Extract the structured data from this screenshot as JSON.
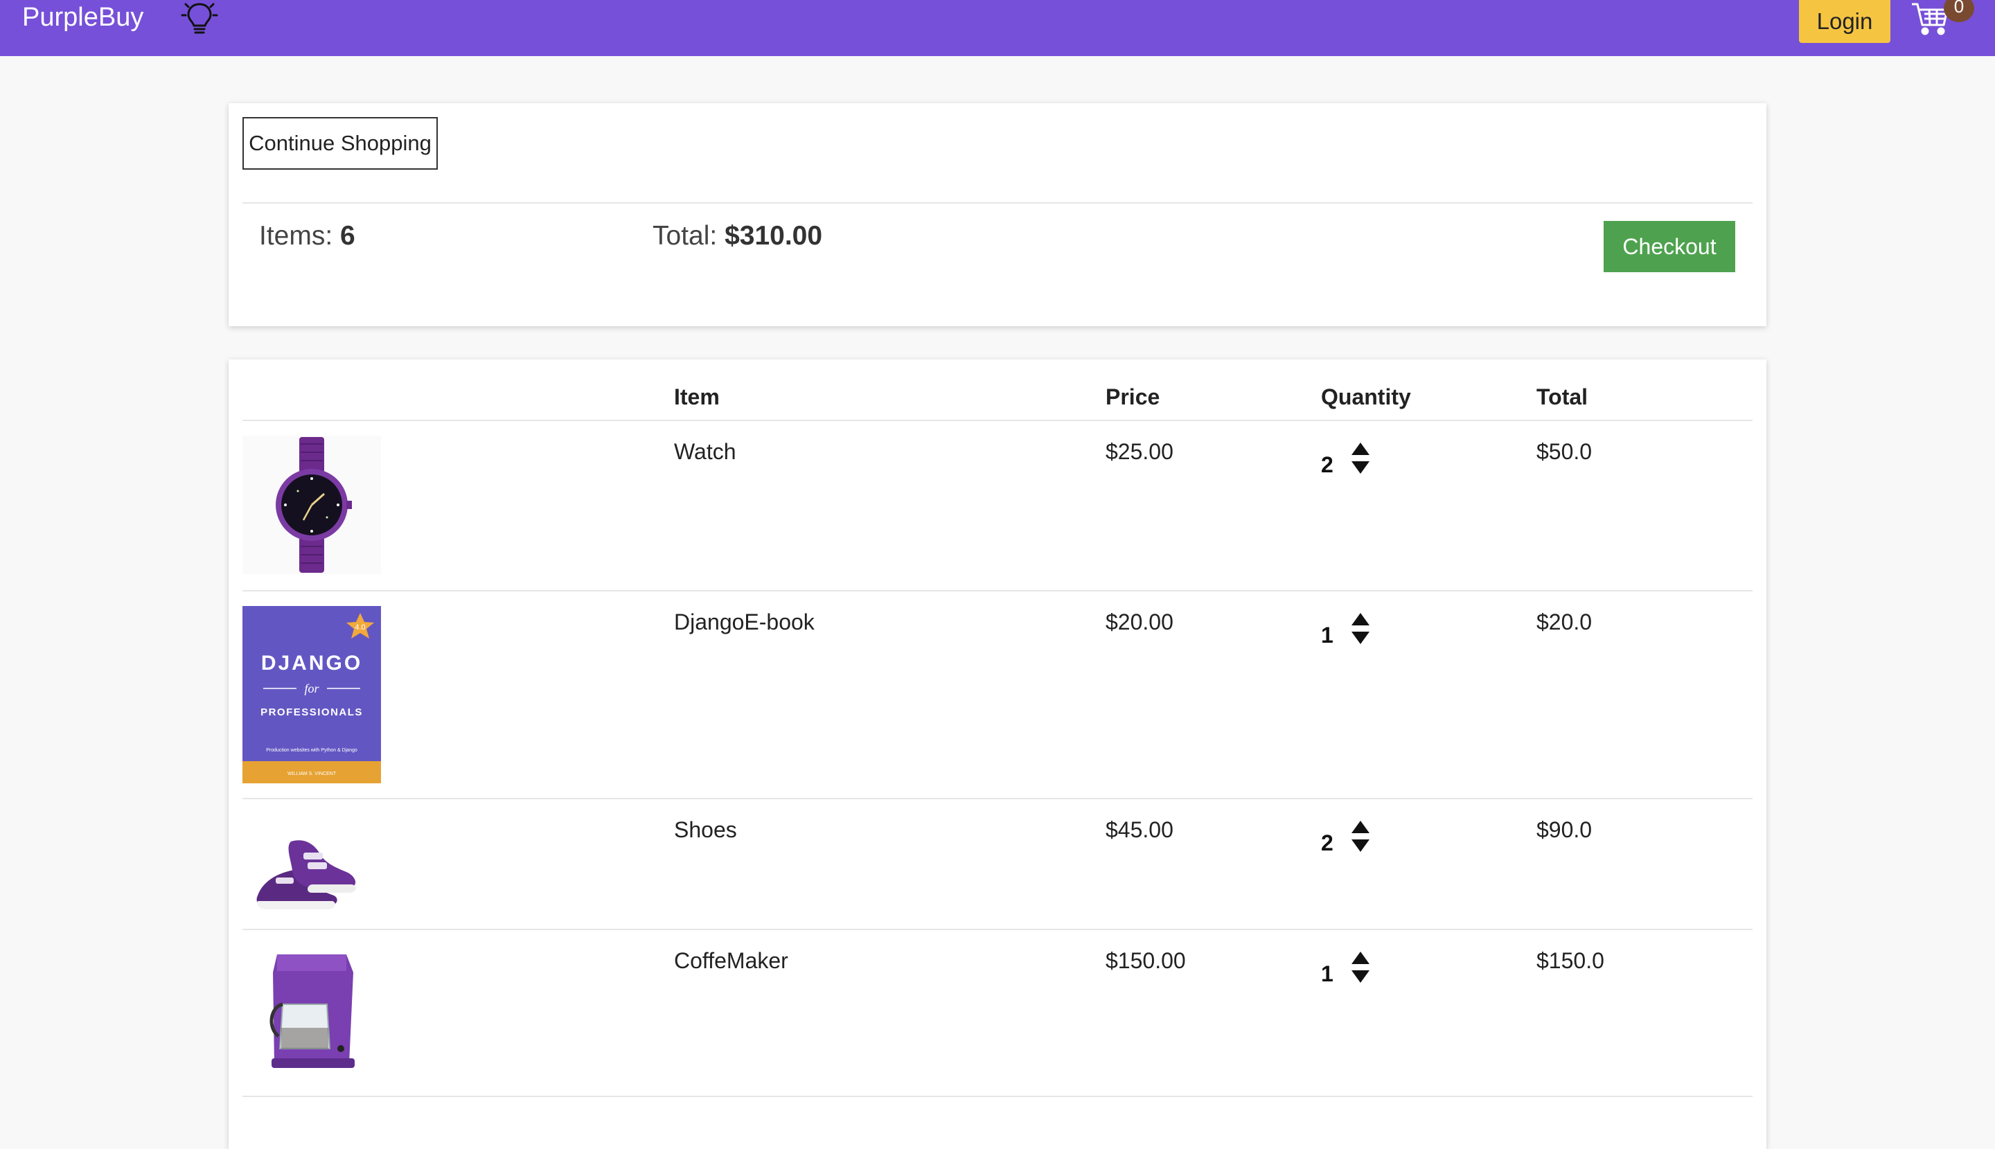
{
  "navbar": {
    "brand": "PurpleBuy",
    "login_label": "Login",
    "cart_count": "0",
    "color": "#7650d8"
  },
  "summary": {
    "continue_label": "Continue Shopping",
    "items_label": "Items:",
    "items_value": "6",
    "total_label": "Total:",
    "total_value": "$310.00",
    "checkout_label": "Checkout"
  },
  "table": {
    "headers": [
      "Item",
      "Price",
      "Quantity",
      "Total"
    ],
    "rows": [
      {
        "item": "Watch",
        "price": "$25.00",
        "quantity": "2",
        "total": "$50.0",
        "image": "watch"
      },
      {
        "item": "DjangoE-book",
        "price": "$20.00",
        "quantity": "1",
        "total": "$20.0",
        "image": "book"
      },
      {
        "item": "Shoes",
        "price": "$45.00",
        "quantity": "2",
        "total": "$90.0",
        "image": "shoes"
      },
      {
        "item": "CoffeMaker",
        "price": "$150.00",
        "quantity": "1",
        "total": "$150.0",
        "image": "coffee-maker"
      }
    ]
  },
  "book_cover": {
    "title": "DJANGO",
    "for": "for",
    "subtitle": "PROFESSIONALS",
    "tagline": "Production websites with Python & Django",
    "author": "WILLIAM S. VINCENT",
    "rating": "4.0"
  },
  "colors": {
    "accent": "#7650d8",
    "login": "#f5c542",
    "checkout": "#4ea24f"
  }
}
